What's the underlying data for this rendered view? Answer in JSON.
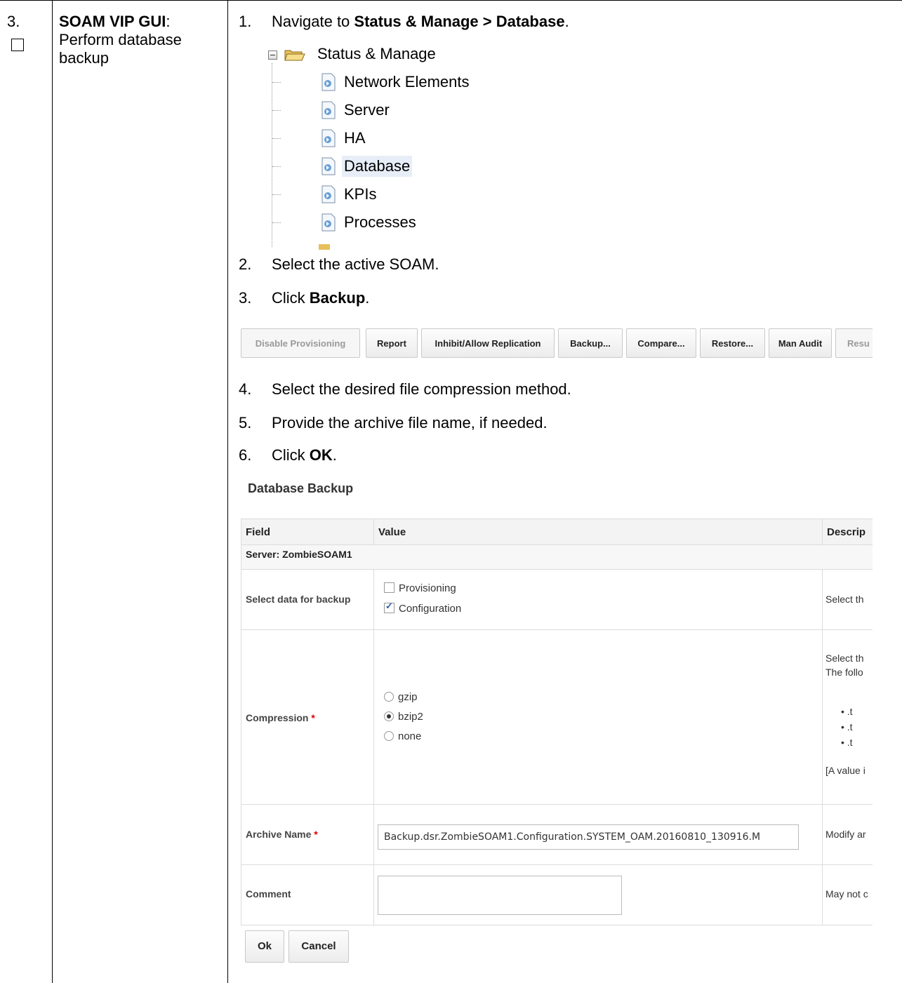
{
  "step": {
    "number": "3.",
    "title_bold": "SOAM VIP GUI",
    "title_colon": ":",
    "title_rest": "Perform database backup"
  },
  "instructions": {
    "i1": {
      "num": "1.",
      "pre": "Navigate to ",
      "bold": "Status & Manage > Database",
      "post": "."
    },
    "i2": {
      "num": "2.",
      "text": "Select the active SOAM."
    },
    "i3": {
      "num": "3.",
      "pre": "Click ",
      "bold": "Backup",
      "post": "."
    },
    "i4": {
      "num": "4.",
      "text": "Select the desired file compression method."
    },
    "i5": {
      "num": "5.",
      "text": "Provide the archive file name, if needed."
    },
    "i6": {
      "num": "6.",
      "pre": "Click ",
      "bold": "OK",
      "post": "."
    }
  },
  "tree": {
    "root": "Status & Manage",
    "items": [
      "Network Elements",
      "Server",
      "HA",
      "Database",
      "KPIs",
      "Processes"
    ],
    "selected": "Database"
  },
  "toolbar": {
    "buttons": [
      "Disable Provisioning",
      "Report",
      "Inhibit/Allow Replication",
      "Backup...",
      "Compare...",
      "Restore...",
      "Man Audit",
      "Resu"
    ]
  },
  "form": {
    "title": "Database Backup",
    "headers": {
      "field": "Field",
      "value": "Value",
      "description": "Descrip"
    },
    "server_row": "Server: ZombieSOAM1",
    "select_data": {
      "label": "Select data for backup",
      "options": [
        "Provisioning",
        "Configuration"
      ],
      "checked": [
        "Configuration"
      ],
      "description": "Select th"
    },
    "compression": {
      "label": "Compression",
      "required_mark": "*",
      "options": [
        "gzip",
        "bzip2",
        "none"
      ],
      "selected": "bzip2",
      "desc_line1": "Select th",
      "desc_line2": "The follo",
      "desc_bullets": [
        ".t",
        ".t",
        ".t"
      ],
      "desc_line3": "[A value i"
    },
    "archive_name": {
      "label": "Archive Name",
      "required_mark": "*",
      "value": "Backup.dsr.ZombieSOAM1.Configuration.SYSTEM_OAM.20160810_130916.M",
      "description": "Modify ar"
    },
    "comment": {
      "label": "Comment",
      "value": "",
      "description": "May not c"
    },
    "ok_label": "Ok",
    "cancel_label": "Cancel"
  }
}
